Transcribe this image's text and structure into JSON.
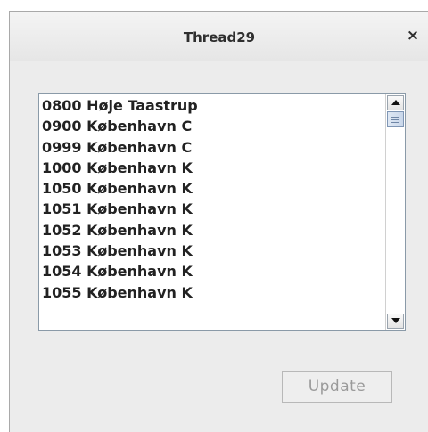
{
  "window": {
    "title": "Thread29",
    "close_glyph": "×"
  },
  "list": {
    "items": [
      "0800 Høje Taastrup",
      "0900 København C",
      "0999 København C",
      "1000 København K",
      "1050 København K",
      "1051 København K",
      "1052 København K",
      "1053 København K",
      "1054 København K",
      "1055 København K"
    ],
    "scroll_position": 0.02
  },
  "buttons": {
    "update_label": "Update",
    "update_enabled": false
  }
}
